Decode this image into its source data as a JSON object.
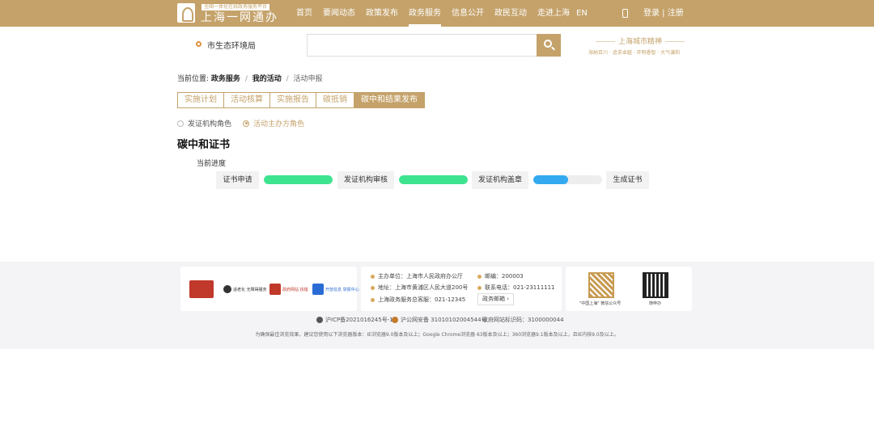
{
  "header": {
    "logo_tagline": "全国一体化在线政务服务平台",
    "logo_title": "上海一网通办",
    "nav": [
      "首页",
      "要闻动态",
      "政策发布",
      "政务服务",
      "信息公开",
      "政民互动",
      "走进上海"
    ],
    "active_nav": "政务服务",
    "lang": "EN",
    "login": "登录 | 注册"
  },
  "search": {
    "location": "市生态环境局",
    "placeholder": "",
    "brand_title": "上海城市精神",
    "brand_sub": "海纳百川 · 追求卓越 · 开明睿智 · 大气谦和"
  },
  "breadcrumb": {
    "prefix": "当前位置:",
    "items": [
      "政务服务",
      "我的活动",
      "活动申报"
    ]
  },
  "tabs": [
    "实施计划",
    "活动核算",
    "实施报告",
    "碳抵销",
    "碳中和结果发布"
  ],
  "active_tab": "碳中和结果发布",
  "roles": [
    {
      "label": "发证机构角色",
      "checked": false
    },
    {
      "label": "活动主办方角色",
      "checked": true
    }
  ],
  "section_title": "碳中和证书",
  "progress_label": "当前进度",
  "progress": {
    "steps": [
      "证书申请",
      "发证机构审核",
      "发证机构盖章",
      "生成证书"
    ],
    "bars": [
      {
        "value": 1.0,
        "color": "#3ee38f"
      },
      {
        "value": 1.0,
        "color": "#3ee38f"
      },
      {
        "value": 0.5,
        "color": "#33aaf0"
      }
    ]
  },
  "footer": {
    "badges": [
      {
        "name": "party-badge",
        "label": "",
        "color": "#c0392b"
      },
      {
        "name": "accessibility-badge",
        "label": "适老化 无障碍服务",
        "color": "#333"
      },
      {
        "name": "gov-error-badge",
        "label": "政府网站 找错",
        "color": "#c0392b"
      },
      {
        "name": "info-security-badge",
        "label": "开放信息 举报中心",
        "color": "#2b6cd4"
      }
    ],
    "host": "主办单位：上海市人民政府办公厅",
    "postcode": "邮编：200003",
    "address": "地址：上海市黄浦区人民大道200号",
    "phone": "联系电话：021-23111111",
    "hotline": "上海政务服务总客服：021-12345",
    "mailbox": "政务邮箱 ›",
    "qr_labels": [
      "\"中国上海\" 微信公众号",
      "随申办"
    ],
    "icp": "沪ICP备2021016245号-1",
    "police": "沪公网安备 31010102004544号",
    "site_id": "政府网站标识码：3100000044",
    "browser_tip": "为确保最佳浏览效果，建议您使用以下浏览器版本：IE浏览器9.0版本及以上；Google Chrome浏览器 63版本及以上；360浏览器9.1版本及以上，且IE内核9.0及以上。"
  }
}
